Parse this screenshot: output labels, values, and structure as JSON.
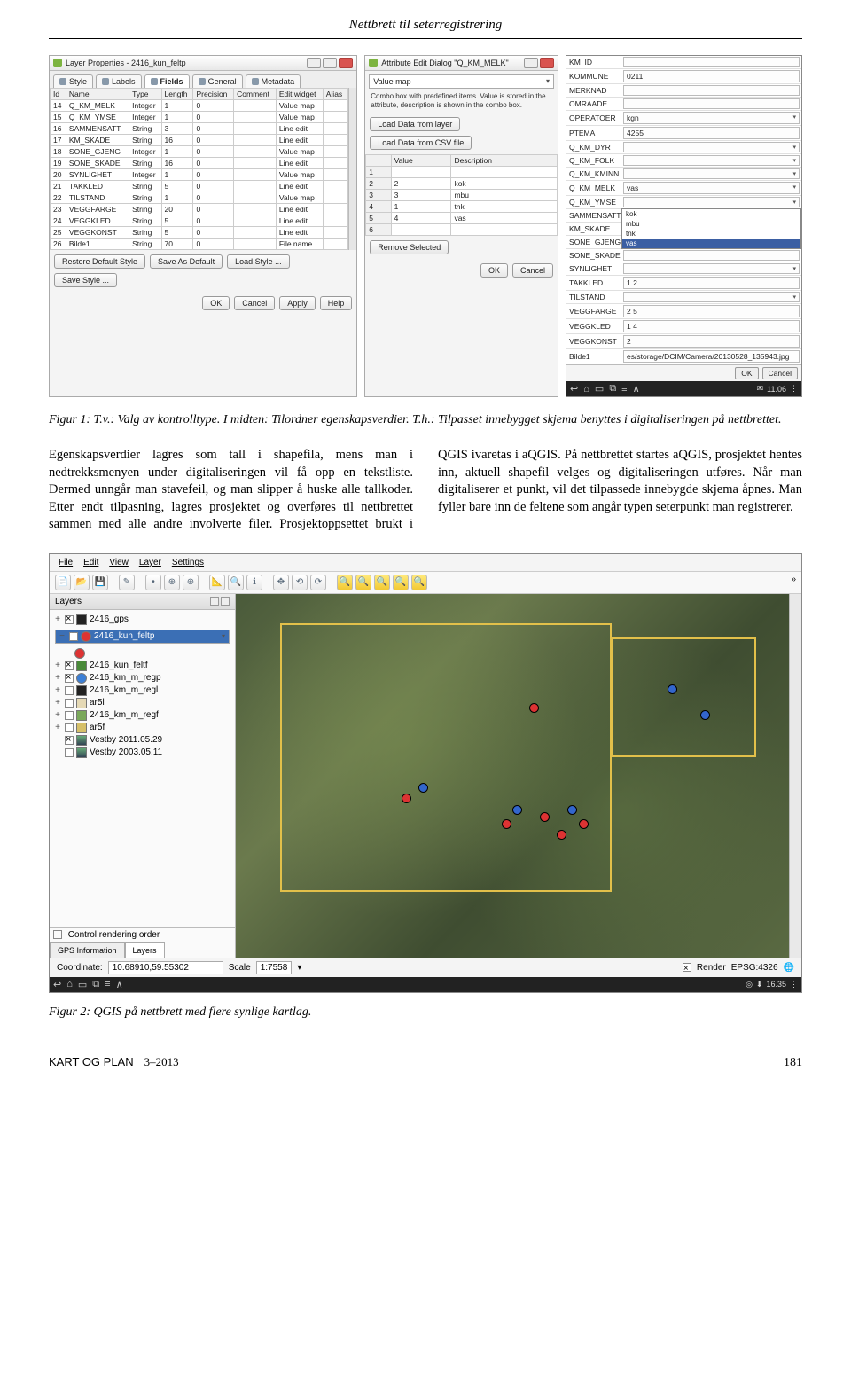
{
  "header": "Nettbrett til seterregistrering",
  "fig1": {
    "panel1": {
      "title": "Layer Properties - 2416_kun_feltp",
      "tabs": [
        "Style",
        "Labels",
        "Fields",
        "General",
        "Metadata"
      ],
      "active_tab": 2,
      "columns": [
        "Id",
        "Name",
        "Type",
        "Length",
        "Precision",
        "Comment",
        "Edit widget",
        "Alias"
      ],
      "rows": [
        [
          "14",
          "Q_KM_MELK",
          "Integer",
          "1",
          "0",
          "",
          "Value map",
          ""
        ],
        [
          "15",
          "Q_KM_YMSE",
          "Integer",
          "1",
          "0",
          "",
          "Value map",
          ""
        ],
        [
          "16",
          "SAMMENSATT",
          "String",
          "3",
          "0",
          "",
          "Line edit",
          ""
        ],
        [
          "17",
          "KM_SKADE",
          "String",
          "16",
          "0",
          "",
          "Line edit",
          ""
        ],
        [
          "18",
          "SONE_GJENG",
          "Integer",
          "1",
          "0",
          "",
          "Value map",
          ""
        ],
        [
          "19",
          "SONE_SKADE",
          "String",
          "16",
          "0",
          "",
          "Line edit",
          ""
        ],
        [
          "20",
          "SYNLIGHET",
          "Integer",
          "1",
          "0",
          "",
          "Value map",
          ""
        ],
        [
          "21",
          "TAKKLED",
          "String",
          "5",
          "0",
          "",
          "Line edit",
          ""
        ],
        [
          "22",
          "TILSTAND",
          "String",
          "1",
          "0",
          "",
          "Value map",
          ""
        ],
        [
          "23",
          "VEGGFARGE",
          "String",
          "20",
          "0",
          "",
          "Line edit",
          ""
        ],
        [
          "24",
          "VEGGKLED",
          "String",
          "5",
          "0",
          "",
          "Line edit",
          ""
        ],
        [
          "25",
          "VEGGKONST",
          "String",
          "5",
          "0",
          "",
          "Line edit",
          ""
        ],
        [
          "26",
          "Bilde1",
          "String",
          "70",
          "0",
          "",
          "File name",
          ""
        ]
      ],
      "buttons_row1": [
        "Restore Default Style",
        "Save As Default",
        "Load Style ...",
        "Save Style ..."
      ],
      "buttons_row2": [
        "OK",
        "Cancel",
        "Apply",
        "Help"
      ]
    },
    "panel2": {
      "title": "Attribute Edit Dialog \"Q_KM_MELK\"",
      "selector": "Value map",
      "note": "Combo box with predefined items. Value is stored in the attribute, description is shown in the combo box.",
      "load_buttons": [
        "Load Data from layer",
        "Load Data from CSV file"
      ],
      "columns": [
        "Value",
        "Description"
      ],
      "rows": [
        [
          "1",
          "",
          ""
        ],
        [
          "2",
          "2",
          "kok"
        ],
        [
          "3",
          "3",
          "mbu"
        ],
        [
          "4",
          "1",
          "tnk"
        ],
        [
          "5",
          "4",
          "vas"
        ],
        [
          "6",
          "",
          ""
        ]
      ],
      "remove_btn": "Remove Selected",
      "ok_cancel": [
        "OK",
        "Cancel"
      ]
    },
    "panel3": {
      "fields": [
        {
          "label": "KM_ID",
          "value": ""
        },
        {
          "label": "KOMMUNE",
          "value": "0211"
        },
        {
          "label": "MERKNAD",
          "value": ""
        },
        {
          "label": "OMRAADE",
          "value": ""
        },
        {
          "label": "OPERATOER",
          "value": "kgn",
          "dd": true
        },
        {
          "label": "PTEMA",
          "value": "4255"
        },
        {
          "label": "Q_KM_DYR",
          "value": "",
          "dd": true
        },
        {
          "label": "Q_KM_FOLK",
          "value": "",
          "dd": true
        },
        {
          "label": "Q_KM_KMINN",
          "value": "",
          "dd": true
        },
        {
          "label": "Q_KM_MELK",
          "value": "vas",
          "dd": true
        },
        {
          "label": "Q_KM_YMSE",
          "value": "",
          "dd": true,
          "dropdown": [
            "kok",
            "mbu",
            "tnk",
            "vas"
          ],
          "hl": 3
        },
        {
          "label": "SAMMENSATT",
          "value": ""
        },
        {
          "label": "KM_SKADE",
          "value": ""
        },
        {
          "label": "SONE_GJENG",
          "value": "",
          "dd": true
        },
        {
          "label": "SONE_SKADE",
          "value": ""
        },
        {
          "label": "SYNLIGHET",
          "value": "",
          "dd": true
        },
        {
          "label": "TAKKLED",
          "value": "1 2"
        },
        {
          "label": "TILSTAND",
          "value": "",
          "dd": true
        },
        {
          "label": "VEGGFARGE",
          "value": "2 5"
        },
        {
          "label": "VEGGKLED",
          "value": "1 4"
        },
        {
          "label": "VEGGKONST",
          "value": "2"
        },
        {
          "label": "Bilde1",
          "value": "es/storage/DCIM/Camera/20130528_135943.jpg"
        }
      ],
      "ok_cancel": [
        "OK",
        "Cancel"
      ],
      "android_time": "11.06"
    }
  },
  "caption1": "Figur 1: T.v.: Valg av kontrolltype. I midten: Tilordner egenskapsverdier. T.h.: Tilpasset innebygget skjema benyttes i digitaliseringen på nettbrettet.",
  "body_text": "Egenskapsverdier lagres som tall i shapefila, mens man i nedtrekksmenyen under digitaliseringen vil få opp en tekstliste. Dermed unngår man stavefeil, og man slipper å huske alle tallkoder. Etter endt tilpasning, lagres prosjektet og overføres til nettbrettet sammen med alle andre involverte filer. Prosjektoppsettet brukt i QGIS ivaretas i aQGIS. På nettbrettet startes aQGIS, prosjektet hentes inn, aktuell shapefil velges og digitaliseringen utføres. Når man digitaliserer et punkt, vil det tilpassede innebygde skjema åpnes. Man fyller bare inn de feltene som angår typen seterpunkt man registrerer.",
  "fig2": {
    "menus": [
      "File",
      "Edit",
      "View",
      "Layer",
      "Settings"
    ],
    "layers_title": "Layers",
    "layers": [
      {
        "exp": "+",
        "chk": true,
        "name": "2416_gps",
        "swatch": "#222",
        "round": false
      },
      {
        "exp": "−",
        "chk": true,
        "name": "2416_kun_feltp",
        "swatch": "#d33",
        "round": true,
        "sel": true
      },
      {
        "exp": "+",
        "chk": true,
        "name": "2416_kun_feltf",
        "swatch": "#4a8a3a",
        "round": false
      },
      {
        "exp": "+",
        "chk": true,
        "name": "2416_km_m_regp",
        "swatch": "#3b7fd6",
        "round": true
      },
      {
        "exp": "+",
        "chk": false,
        "name": "2416_km_m_regl",
        "swatch": "#222",
        "round": false
      },
      {
        "exp": "+",
        "chk": false,
        "name": "ar5l",
        "swatch": "#e5d9b5",
        "round": false
      },
      {
        "exp": "+",
        "chk": false,
        "name": "2416_km_m_regf",
        "swatch": "#7aa85a",
        "round": false
      },
      {
        "exp": "+",
        "chk": false,
        "name": "ar5f",
        "swatch": "#d6c069",
        "round": false
      },
      {
        "exp": "",
        "chk": true,
        "name": "Vestby 2011.05.29",
        "swatch": "",
        "round": false,
        "img": true
      },
      {
        "exp": "",
        "chk": false,
        "name": "Vestby 2003.05.11",
        "swatch": "",
        "round": false,
        "img": true
      }
    ],
    "control_rendering": "Control rendering order",
    "tabs": [
      "GPS Information",
      "Layers"
    ],
    "active_tab": 1,
    "status": {
      "coord_label": "Coordinate:",
      "coord": "10.68910,59.55302",
      "scale_label": "Scale",
      "scale": "1:7558",
      "render": "Render",
      "epsg": "EPSG:4326"
    },
    "android_time": "16.35"
  },
  "caption2": "Figur 2: QGIS på nettbrett med flere synlige kartlag.",
  "footer": {
    "left": "KART OG PLAN",
    "issue": "3–2013",
    "page": "181"
  }
}
